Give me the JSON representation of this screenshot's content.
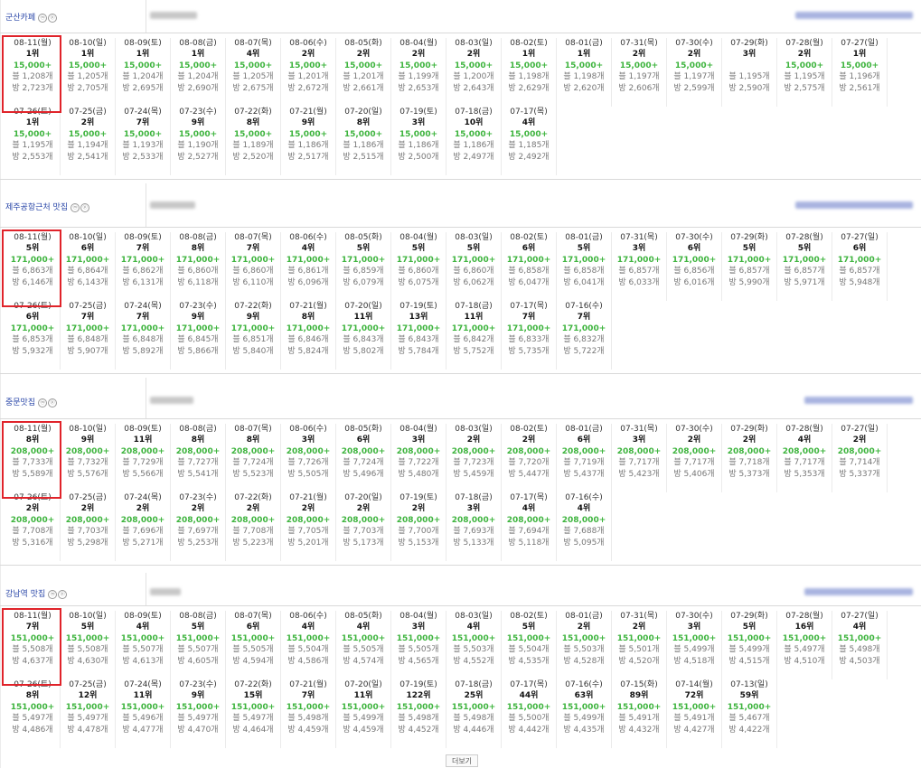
{
  "more_label": "더보기",
  "sections": [
    {
      "title": "군산카페",
      "icons": [
        "ⓜ",
        "ⓟ"
      ],
      "cells": [
        {
          "date": "08-11(월)",
          "rank": "1위",
          "search": "15,000+",
          "posts": "블 1,208개",
          "rooms": "방 2,723개"
        },
        {
          "date": "08-10(일)",
          "rank": "1위",
          "search": "15,000+",
          "posts": "블 1,205개",
          "rooms": "방 2,705개"
        },
        {
          "date": "08-09(토)",
          "rank": "1위",
          "search": "15,000+",
          "posts": "블 1,204개",
          "rooms": "방 2,695개"
        },
        {
          "date": "08-08(금)",
          "rank": "1위",
          "search": "15,000+",
          "posts": "블 1,204개",
          "rooms": "방 2,690개"
        },
        {
          "date": "08-07(목)",
          "rank": "4위",
          "search": "15,000+",
          "posts": "블 1,205개",
          "rooms": "방 2,675개"
        },
        {
          "date": "08-06(수)",
          "rank": "2위",
          "search": "15,000+",
          "posts": "블 1,201개",
          "rooms": "방 2,672개"
        },
        {
          "date": "08-05(화)",
          "rank": "2위",
          "search": "15,000+",
          "posts": "블 1,201개",
          "rooms": "방 2,661개"
        },
        {
          "date": "08-04(월)",
          "rank": "2위",
          "search": "15,000+",
          "posts": "블 1,199개",
          "rooms": "방 2,653개"
        },
        {
          "date": "08-03(일)",
          "rank": "2위",
          "search": "15,000+",
          "posts": "블 1,200개",
          "rooms": "방 2,643개"
        },
        {
          "date": "08-02(토)",
          "rank": "1위",
          "search": "15,000+",
          "posts": "블 1,198개",
          "rooms": "방 2,629개"
        },
        {
          "date": "08-01(금)",
          "rank": "1위",
          "search": "15,000+",
          "posts": "블 1,198개",
          "rooms": "방 2,620개"
        },
        {
          "date": "07-31(목)",
          "rank": "2위",
          "search": "15,000+",
          "posts": "블 1,197개",
          "rooms": "방 2,606개"
        },
        {
          "date": "07-30(수)",
          "rank": "2위",
          "search": "15,000+",
          "posts": "블 1,197개",
          "rooms": "방 2,599개"
        },
        {
          "date": "07-29(화)",
          "rank": "3위",
          "search": "",
          "posts": "블 1,195개",
          "rooms": "방 2,590개"
        },
        {
          "date": "07-28(월)",
          "rank": "2위",
          "search": "15,000+",
          "posts": "블 1,195개",
          "rooms": "방 2,575개"
        },
        {
          "date": "07-27(일)",
          "rank": "1위",
          "search": "15,000+",
          "posts": "블 1,196개",
          "rooms": "방 2,561개"
        },
        {
          "date": "07-26(토)",
          "rank": "1위",
          "search": "15,000+",
          "posts": "블 1,195개",
          "rooms": "방 2,553개"
        },
        {
          "date": "07-25(금)",
          "rank": "2위",
          "search": "15,000+",
          "posts": "블 1,194개",
          "rooms": "방 2,541개"
        },
        {
          "date": "07-24(목)",
          "rank": "7위",
          "search": "15,000+",
          "posts": "블 1,193개",
          "rooms": "방 2,533개"
        },
        {
          "date": "07-23(수)",
          "rank": "9위",
          "search": "15,000+",
          "posts": "블 1,190개",
          "rooms": "방 2,527개"
        },
        {
          "date": "07-22(화)",
          "rank": "8위",
          "search": "15,000+",
          "posts": "블 1,189개",
          "rooms": "방 2,520개"
        },
        {
          "date": "07-21(월)",
          "rank": "9위",
          "search": "15,000+",
          "posts": "블 1,186개",
          "rooms": "방 2,517개"
        },
        {
          "date": "07-20(일)",
          "rank": "8위",
          "search": "15,000+",
          "posts": "블 1,186개",
          "rooms": "방 2,515개"
        },
        {
          "date": "07-19(토)",
          "rank": "3위",
          "search": "15,000+",
          "posts": "블 1,186개",
          "rooms": "방 2,500개"
        },
        {
          "date": "07-18(금)",
          "rank": "10위",
          "search": "15,000+",
          "posts": "블 1,186개",
          "rooms": "방 2,497개"
        },
        {
          "date": "07-17(목)",
          "rank": "4위",
          "search": "15,000+",
          "posts": "블 1,185개",
          "rooms": "방 2,492개"
        }
      ]
    },
    {
      "title": "제주공항근처 맛집",
      "icons": [
        "ⓜ",
        "ⓟ"
      ],
      "cells": [
        {
          "date": "08-11(월)",
          "rank": "5위",
          "search": "171,000+",
          "posts": "블 6,863개",
          "rooms": "방 6,146개"
        },
        {
          "date": "08-10(일)",
          "rank": "6위",
          "search": "171,000+",
          "posts": "블 6,864개",
          "rooms": "방 6,143개"
        },
        {
          "date": "08-09(토)",
          "rank": "7위",
          "search": "171,000+",
          "posts": "블 6,862개",
          "rooms": "방 6,131개"
        },
        {
          "date": "08-08(금)",
          "rank": "8위",
          "search": "171,000+",
          "posts": "블 6,860개",
          "rooms": "방 6,118개"
        },
        {
          "date": "08-07(목)",
          "rank": "7위",
          "search": "171,000+",
          "posts": "블 6,860개",
          "rooms": "방 6,110개"
        },
        {
          "date": "08-06(수)",
          "rank": "4위",
          "search": "171,000+",
          "posts": "블 6,861개",
          "rooms": "방 6,096개"
        },
        {
          "date": "08-05(화)",
          "rank": "5위",
          "search": "171,000+",
          "posts": "블 6,859개",
          "rooms": "방 6,079개"
        },
        {
          "date": "08-04(월)",
          "rank": "5위",
          "search": "171,000+",
          "posts": "블 6,860개",
          "rooms": "방 6,075개"
        },
        {
          "date": "08-03(일)",
          "rank": "5위",
          "search": "171,000+",
          "posts": "블 6,860개",
          "rooms": "방 6,062개"
        },
        {
          "date": "08-02(토)",
          "rank": "6위",
          "search": "171,000+",
          "posts": "블 6,858개",
          "rooms": "방 6,047개"
        },
        {
          "date": "08-01(금)",
          "rank": "5위",
          "search": "171,000+",
          "posts": "블 6,858개",
          "rooms": "방 6,041개"
        },
        {
          "date": "07-31(목)",
          "rank": "3위",
          "search": "171,000+",
          "posts": "블 6,857개",
          "rooms": "방 6,033개"
        },
        {
          "date": "07-30(수)",
          "rank": "6위",
          "search": "171,000+",
          "posts": "블 6,856개",
          "rooms": "방 6,016개"
        },
        {
          "date": "07-29(화)",
          "rank": "5위",
          "search": "171,000+",
          "posts": "블 6,857개",
          "rooms": "방 5,990개"
        },
        {
          "date": "07-28(월)",
          "rank": "5위",
          "search": "171,000+",
          "posts": "블 6,857개",
          "rooms": "방 5,971개"
        },
        {
          "date": "07-27(일)",
          "rank": "6위",
          "search": "171,000+",
          "posts": "블 6,857개",
          "rooms": "방 5,948개"
        },
        {
          "date": "07-26(토)",
          "rank": "6위",
          "search": "171,000+",
          "posts": "블 6,853개",
          "rooms": "방 5,932개"
        },
        {
          "date": "07-25(금)",
          "rank": "7위",
          "search": "171,000+",
          "posts": "블 6,848개",
          "rooms": "방 5,907개"
        },
        {
          "date": "07-24(목)",
          "rank": "7위",
          "search": "171,000+",
          "posts": "블 6,848개",
          "rooms": "방 5,892개"
        },
        {
          "date": "07-23(수)",
          "rank": "9위",
          "search": "171,000+",
          "posts": "블 6,845개",
          "rooms": "방 5,866개"
        },
        {
          "date": "07-22(화)",
          "rank": "9위",
          "search": "171,000+",
          "posts": "블 6,851개",
          "rooms": "방 5,840개"
        },
        {
          "date": "07-21(월)",
          "rank": "8위",
          "search": "171,000+",
          "posts": "블 6,846개",
          "rooms": "방 5,824개"
        },
        {
          "date": "07-20(일)",
          "rank": "11위",
          "search": "171,000+",
          "posts": "블 6,843개",
          "rooms": "방 5,802개"
        },
        {
          "date": "07-19(토)",
          "rank": "13위",
          "search": "171,000+",
          "posts": "블 6,843개",
          "rooms": "방 5,784개"
        },
        {
          "date": "07-18(금)",
          "rank": "11위",
          "search": "171,000+",
          "posts": "블 6,842개",
          "rooms": "방 5,752개"
        },
        {
          "date": "07-17(목)",
          "rank": "7위",
          "search": "171,000+",
          "posts": "블 6,833개",
          "rooms": "방 5,735개"
        },
        {
          "date": "07-16(수)",
          "rank": "7위",
          "search": "171,000+",
          "posts": "블 6,832개",
          "rooms": "방 5,722개"
        }
      ]
    },
    {
      "title": "중문맛집",
      "icons": [
        "ⓜ",
        "ⓟ"
      ],
      "cells": [
        {
          "date": "08-11(월)",
          "rank": "8위",
          "search": "208,000+",
          "posts": "블 7,733개",
          "rooms": "방 5,589개"
        },
        {
          "date": "08-10(일)",
          "rank": "9위",
          "search": "208,000+",
          "posts": "블 7,732개",
          "rooms": "방 5,576개"
        },
        {
          "date": "08-09(토)",
          "rank": "11위",
          "search": "208,000+",
          "posts": "블 7,729개",
          "rooms": "방 5,566개"
        },
        {
          "date": "08-08(금)",
          "rank": "8위",
          "search": "208,000+",
          "posts": "블 7,727개",
          "rooms": "방 5,541개"
        },
        {
          "date": "08-07(목)",
          "rank": "8위",
          "search": "208,000+",
          "posts": "블 7,724개",
          "rooms": "방 5,523개"
        },
        {
          "date": "08-06(수)",
          "rank": "3위",
          "search": "208,000+",
          "posts": "블 7,726개",
          "rooms": "방 5,505개"
        },
        {
          "date": "08-05(화)",
          "rank": "6위",
          "search": "208,000+",
          "posts": "블 7,724개",
          "rooms": "방 5,496개"
        },
        {
          "date": "08-04(월)",
          "rank": "3위",
          "search": "208,000+",
          "posts": "블 7,722개",
          "rooms": "방 5,480개"
        },
        {
          "date": "08-03(일)",
          "rank": "2위",
          "search": "208,000+",
          "posts": "블 7,723개",
          "rooms": "방 5,459개"
        },
        {
          "date": "08-02(토)",
          "rank": "2위",
          "search": "208,000+",
          "posts": "블 7,720개",
          "rooms": "방 5,447개"
        },
        {
          "date": "08-01(금)",
          "rank": "6위",
          "search": "208,000+",
          "posts": "블 7,719개",
          "rooms": "방 5,437개"
        },
        {
          "date": "07-31(목)",
          "rank": "3위",
          "search": "208,000+",
          "posts": "블 7,717개",
          "rooms": "방 5,423개"
        },
        {
          "date": "07-30(수)",
          "rank": "2위",
          "search": "208,000+",
          "posts": "블 7,717개",
          "rooms": "방 5,406개"
        },
        {
          "date": "07-29(화)",
          "rank": "2위",
          "search": "208,000+",
          "posts": "블 7,718개",
          "rooms": "방 5,373개"
        },
        {
          "date": "07-28(월)",
          "rank": "4위",
          "search": "208,000+",
          "posts": "블 7,717개",
          "rooms": "방 5,353개"
        },
        {
          "date": "07-27(일)",
          "rank": "2위",
          "search": "208,000+",
          "posts": "블 7,714개",
          "rooms": "방 5,337개"
        },
        {
          "date": "07-26(토)",
          "rank": "2위",
          "search": "208,000+",
          "posts": "블 7,708개",
          "rooms": "방 5,316개"
        },
        {
          "date": "07-25(금)",
          "rank": "2위",
          "search": "208,000+",
          "posts": "블 7,703개",
          "rooms": "방 5,298개"
        },
        {
          "date": "07-24(목)",
          "rank": "2위",
          "search": "208,000+",
          "posts": "블 7,696개",
          "rooms": "방 5,271개"
        },
        {
          "date": "07-23(수)",
          "rank": "2위",
          "search": "208,000+",
          "posts": "블 7,697개",
          "rooms": "방 5,253개"
        },
        {
          "date": "07-22(화)",
          "rank": "2위",
          "search": "208,000+",
          "posts": "블 7,708개",
          "rooms": "방 5,223개"
        },
        {
          "date": "07-21(월)",
          "rank": "2위",
          "search": "208,000+",
          "posts": "블 7,705개",
          "rooms": "방 5,201개"
        },
        {
          "date": "07-20(일)",
          "rank": "2위",
          "search": "208,000+",
          "posts": "블 7,703개",
          "rooms": "방 5,173개"
        },
        {
          "date": "07-19(토)",
          "rank": "2위",
          "search": "208,000+",
          "posts": "블 7,700개",
          "rooms": "방 5,153개"
        },
        {
          "date": "07-18(금)",
          "rank": "3위",
          "search": "208,000+",
          "posts": "블 7,693개",
          "rooms": "방 5,133개"
        },
        {
          "date": "07-17(목)",
          "rank": "4위",
          "search": "208,000+",
          "posts": "블 7,694개",
          "rooms": "방 5,118개"
        },
        {
          "date": "07-16(수)",
          "rank": "4위",
          "search": "208,000+",
          "posts": "블 7,688개",
          "rooms": "방 5,095개"
        }
      ]
    },
    {
      "title": "강남역 맛집",
      "icons": [
        "ⓜ",
        "ⓟ"
      ],
      "cells": [
        {
          "date": "08-11(월)",
          "rank": "7위",
          "search": "151,000+",
          "posts": "블 5,508개",
          "rooms": "방 4,637개"
        },
        {
          "date": "08-10(일)",
          "rank": "5위",
          "search": "151,000+",
          "posts": "블 5,508개",
          "rooms": "방 4,630개"
        },
        {
          "date": "08-09(토)",
          "rank": "4위",
          "search": "151,000+",
          "posts": "블 5,507개",
          "rooms": "방 4,613개"
        },
        {
          "date": "08-08(금)",
          "rank": "5위",
          "search": "151,000+",
          "posts": "블 5,507개",
          "rooms": "방 4,605개"
        },
        {
          "date": "08-07(목)",
          "rank": "6위",
          "search": "151,000+",
          "posts": "블 5,505개",
          "rooms": "방 4,594개"
        },
        {
          "date": "08-06(수)",
          "rank": "4위",
          "search": "151,000+",
          "posts": "블 5,504개",
          "rooms": "방 4,586개"
        },
        {
          "date": "08-05(화)",
          "rank": "4위",
          "search": "151,000+",
          "posts": "블 5,505개",
          "rooms": "방 4,574개"
        },
        {
          "date": "08-04(월)",
          "rank": "3위",
          "search": "151,000+",
          "posts": "블 5,505개",
          "rooms": "방 4,565개"
        },
        {
          "date": "08-03(일)",
          "rank": "4위",
          "search": "151,000+",
          "posts": "블 5,503개",
          "rooms": "방 4,552개"
        },
        {
          "date": "08-02(토)",
          "rank": "5위",
          "search": "151,000+",
          "posts": "블 5,504개",
          "rooms": "방 4,535개"
        },
        {
          "date": "08-01(금)",
          "rank": "2위",
          "search": "151,000+",
          "posts": "블 5,503개",
          "rooms": "방 4,528개"
        },
        {
          "date": "07-31(목)",
          "rank": "2위",
          "search": "151,000+",
          "posts": "블 5,501개",
          "rooms": "방 4,520개"
        },
        {
          "date": "07-30(수)",
          "rank": "3위",
          "search": "151,000+",
          "posts": "블 5,499개",
          "rooms": "방 4,518개"
        },
        {
          "date": "07-29(화)",
          "rank": "5위",
          "search": "151,000+",
          "posts": "블 5,499개",
          "rooms": "방 4,515개"
        },
        {
          "date": "07-28(월)",
          "rank": "16위",
          "search": "151,000+",
          "posts": "블 5,497개",
          "rooms": "방 4,510개"
        },
        {
          "date": "07-27(일)",
          "rank": "4위",
          "search": "151,000+",
          "posts": "블 5,498개",
          "rooms": "방 4,503개"
        },
        {
          "date": "07-26(토)",
          "rank": "8위",
          "search": "151,000+",
          "posts": "블 5,497개",
          "rooms": "방 4,486개"
        },
        {
          "date": "07-25(금)",
          "rank": "12위",
          "search": "151,000+",
          "posts": "블 5,497개",
          "rooms": "방 4,478개"
        },
        {
          "date": "07-24(목)",
          "rank": "11위",
          "search": "151,000+",
          "posts": "블 5,496개",
          "rooms": "방 4,477개"
        },
        {
          "date": "07-23(수)",
          "rank": "9위",
          "search": "151,000+",
          "posts": "블 5,497개",
          "rooms": "방 4,470개"
        },
        {
          "date": "07-22(화)",
          "rank": "15위",
          "search": "151,000+",
          "posts": "블 5,497개",
          "rooms": "방 4,464개"
        },
        {
          "date": "07-21(월)",
          "rank": "7위",
          "search": "151,000+",
          "posts": "블 5,498개",
          "rooms": "방 4,459개"
        },
        {
          "date": "07-20(일)",
          "rank": "11위",
          "search": "151,000+",
          "posts": "블 5,499개",
          "rooms": "방 4,459개"
        },
        {
          "date": "07-19(토)",
          "rank": "122위",
          "search": "151,000+",
          "posts": "블 5,498개",
          "rooms": "방 4,452개"
        },
        {
          "date": "07-18(금)",
          "rank": "25위",
          "search": "151,000+",
          "posts": "블 5,498개",
          "rooms": "방 4,446개"
        },
        {
          "date": "07-17(목)",
          "rank": "44위",
          "search": "151,000+",
          "posts": "블 5,500개",
          "rooms": "방 4,442개"
        },
        {
          "date": "07-16(수)",
          "rank": "63위",
          "search": "151,000+",
          "posts": "블 5,499개",
          "rooms": "방 4,435개"
        },
        {
          "date": "07-15(화)",
          "rank": "89위",
          "search": "151,000+",
          "posts": "블 5,491개",
          "rooms": "방 4,432개"
        },
        {
          "date": "07-14(월)",
          "rank": "72위",
          "search": "151,000+",
          "posts": "블 5,491개",
          "rooms": "방 4,427개"
        },
        {
          "date": "07-13(일)",
          "rank": "59위",
          "search": "151,000+",
          "posts": "블 5,467개",
          "rooms": "방 4,422개"
        }
      ]
    }
  ]
}
